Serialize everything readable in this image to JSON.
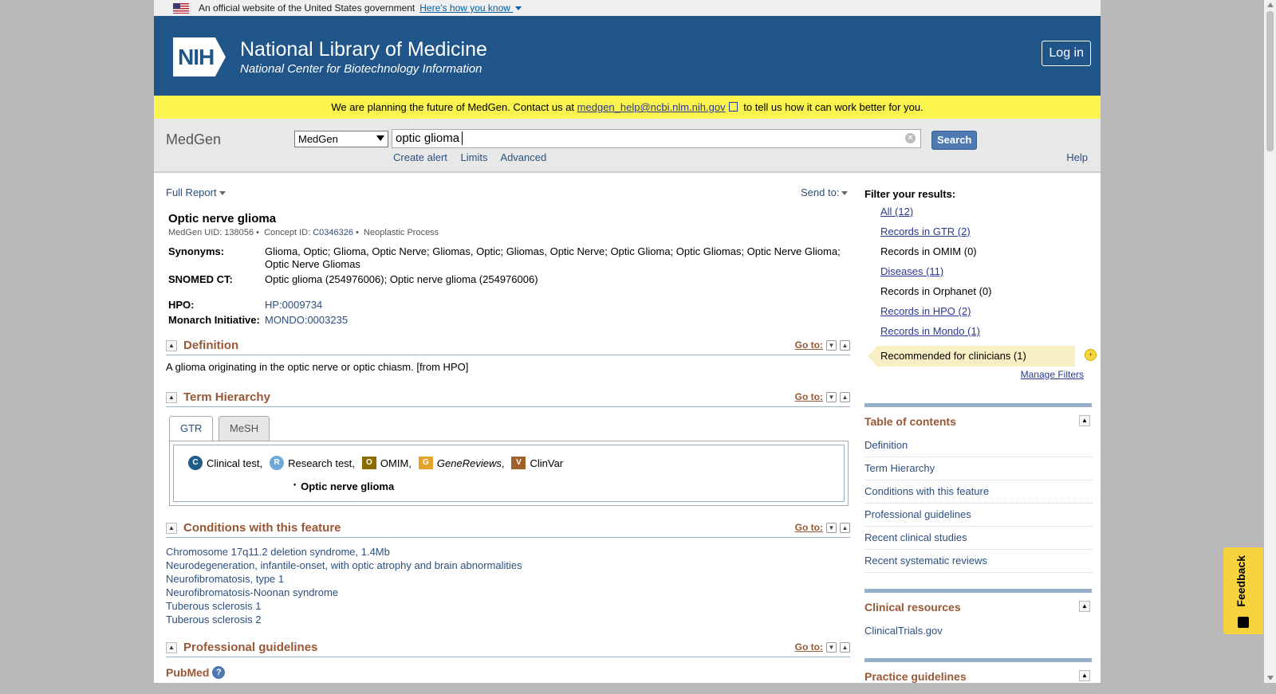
{
  "govbar": {
    "text": "An official website of the United States government",
    "link": "Here's how you know"
  },
  "header": {
    "logo": "NIH",
    "title": "National Library of Medicine",
    "subtitle": "National Center for Biotechnology Information",
    "login": "Log in"
  },
  "banner": {
    "text_before": "We are planning the future of MedGen. Contact us at",
    "email": "medgen_help@ncbi.nlm.nih.gov",
    "text_after": "to tell us how it can work better for you."
  },
  "search": {
    "db_name": "MedGen",
    "db_selected": "MedGen",
    "query": "optic glioma",
    "button": "Search",
    "links": [
      "Create alert",
      "Limits",
      "Advanced"
    ],
    "help": "Help"
  },
  "toolbar": {
    "format": "Full Report",
    "send_to": "Send to:"
  },
  "record": {
    "title": "Optic nerve glioma",
    "uid_label": "MedGen UID:",
    "uid": "138056",
    "concept_label": "Concept ID:",
    "concept_id": "C0346326",
    "semantic_type": "Neoplastic Process",
    "synonyms_label": "Synonyms:",
    "synonyms": "Glioma, Optic; Glioma, Optic Nerve; Gliomas, Optic; Gliomas, Optic Nerve; Optic Glioma; Optic Gliomas; Optic Nerve Glioma; Optic Nerve Gliomas",
    "snomed_label": "SNOMED CT:",
    "snomed": "Optic glioma (254976006); Optic nerve glioma (254976006)",
    "hpo_label": "HPO:",
    "hpo": "HP:0009734",
    "monarch_label": "Monarch Initiative:",
    "monarch": "MONDO:0003235"
  },
  "sections": {
    "goto": "Go to:",
    "definition": {
      "title": "Definition",
      "text": "A glioma originating in the optic nerve or optic chiasm. [from HPO]"
    },
    "hierarchy": {
      "title": "Term Hierarchy",
      "tabs": [
        "GTR",
        "MeSH"
      ],
      "legend": [
        {
          "badge": "C",
          "label": "Clinical test,"
        },
        {
          "badge": "R",
          "label": "Research test,"
        },
        {
          "badge": "O",
          "label": "OMIM,"
        },
        {
          "badge": "G",
          "label": "GeneReviews"
        },
        {
          "badge": "V",
          "label": "ClinVar"
        }
      ],
      "legend_comma": ",",
      "node": "Optic nerve glioma"
    },
    "conditions": {
      "title": "Conditions with this feature",
      "items": [
        "Chromosome 17q11.2 deletion syndrome, 1.4Mb",
        "Neurodegeneration, infantile-onset, with optic atrophy and brain abnormalities",
        "Neurofibromatosis, type 1",
        "Neurofibromatosis-Noonan syndrome",
        "Tuberous sclerosis 1",
        "Tuberous sclerosis 2"
      ]
    },
    "guidelines": {
      "title": "Professional guidelines",
      "pubmed": "PubMed"
    }
  },
  "sidebar": {
    "filter_title": "Filter your results:",
    "filters": [
      {
        "label": "All (12)",
        "link": true
      },
      {
        "label": "Records in GTR (2)",
        "link": true
      },
      {
        "label": "Records in OMIM (0)",
        "link": false
      },
      {
        "label": "Diseases (11)",
        "link": true
      },
      {
        "label": "Records in Orphanet (0)",
        "link": false
      },
      {
        "label": "Records in HPO (2)",
        "link": true
      },
      {
        "label": "Records in Mondo (1)",
        "link": true
      }
    ],
    "recommended": "Recommended for clinicians (1)",
    "manage": "Manage Filters",
    "toc_title": "Table of contents",
    "toc": [
      "Definition",
      "Term Hierarchy",
      "Conditions with this feature",
      "Professional guidelines",
      "Recent clinical studies",
      "Recent systematic reviews"
    ],
    "clinical_title": "Clinical resources",
    "clinical": [
      "ClinicalTrials.gov"
    ],
    "practice_title": "Practice guidelines"
  },
  "feedback": "Feedback",
  "colors": {
    "header": "#20558a",
    "banner": "#fbf34e",
    "section_title": "#985735"
  }
}
